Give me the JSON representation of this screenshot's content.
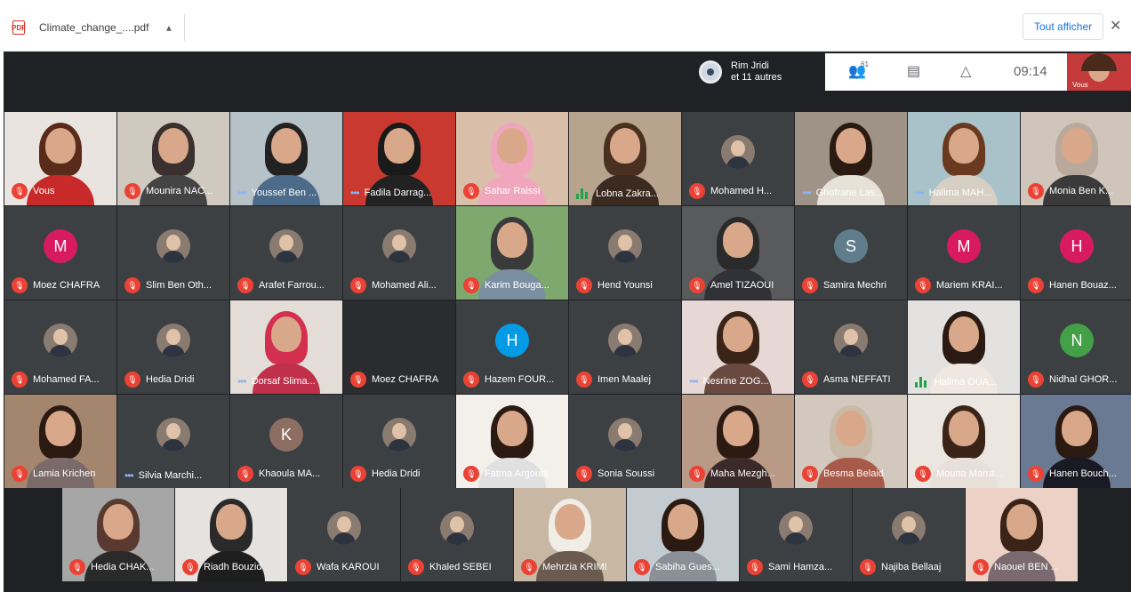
{
  "download_bar": {
    "file_name": "Climate_change_....pdf",
    "pdf_label": "PDF",
    "show_all": "Tout afficher",
    "close": "✕"
  },
  "meeting": {
    "active_speaker": {
      "line1": "Rim Jridi",
      "line2": "et 11 autres"
    },
    "participant_count": "61",
    "time": "09:14",
    "self_label": "Vous"
  },
  "colors": {
    "mic_off": "#ea4335",
    "background": "#202124",
    "tile": "#3c4043"
  },
  "participants": [
    {
      "name": "Vous",
      "mic": "off",
      "kind": "video",
      "scene": "red"
    },
    {
      "name": "Mounira NAC...",
      "mic": "off",
      "kind": "video",
      "scene": "office"
    },
    {
      "name": "Youssef Ben ...",
      "mic": "dots",
      "kind": "video",
      "scene": "office2"
    },
    {
      "name": "Fadila Darrag...",
      "mic": "dots",
      "kind": "video",
      "scene": "flag"
    },
    {
      "name": "Sahar Raissi",
      "mic": "off",
      "kind": "video",
      "scene": "hijab"
    },
    {
      "name": "Lobna Zakra...",
      "mic": "bars",
      "kind": "video",
      "scene": "curly"
    },
    {
      "name": "Mohamed H...",
      "mic": "off",
      "kind": "photo"
    },
    {
      "name": "Ghofrane Las...",
      "mic": "dots",
      "kind": "video",
      "scene": "glasses"
    },
    {
      "name": "Halima MAH...",
      "mic": "dots",
      "kind": "video",
      "scene": "kitchen"
    },
    {
      "name": "Monia Ben K...",
      "mic": "off",
      "kind": "video",
      "scene": "hijab2"
    },
    {
      "name": "Moez CHAFRA",
      "mic": "off",
      "kind": "letter",
      "letter": "M",
      "color": "#d81b60"
    },
    {
      "name": "Slim Ben Oth...",
      "mic": "off",
      "kind": "photo"
    },
    {
      "name": "Arafet Farrou...",
      "mic": "off",
      "kind": "photo"
    },
    {
      "name": "Mohamed Ali...",
      "mic": "off",
      "kind": "photo"
    },
    {
      "name": "Karim Bouga...",
      "mic": "off",
      "kind": "video",
      "scene": "green"
    },
    {
      "name": "Hend Younsi",
      "mic": "off",
      "kind": "photo"
    },
    {
      "name": "Amel TIZAOUI",
      "mic": "off",
      "kind": "video",
      "scene": "room"
    },
    {
      "name": "Samira Mechri",
      "mic": "off",
      "kind": "letter",
      "letter": "S",
      "color": "#607d8b"
    },
    {
      "name": "Mariem KRAI...",
      "mic": "off",
      "kind": "letter",
      "letter": "M",
      "color": "#d81b60"
    },
    {
      "name": "Hanen Bouaz...",
      "mic": "off",
      "kind": "letter",
      "letter": "H",
      "color": "#d81b60"
    },
    {
      "name": "Mohamed FA...",
      "mic": "off",
      "kind": "photo"
    },
    {
      "name": "Hedia Dridi",
      "mic": "off",
      "kind": "photo"
    },
    {
      "name": "Dorsaf Slima...",
      "mic": "dots",
      "kind": "video",
      "scene": "redhijab"
    },
    {
      "name": "Moez CHAFRA",
      "mic": "off",
      "kind": "blank"
    },
    {
      "name": "Hazem FOUR...",
      "mic": "off",
      "kind": "letter",
      "letter": "H",
      "color": "#039be5"
    },
    {
      "name": "Imen Maalej",
      "mic": "off",
      "kind": "photo"
    },
    {
      "name": "Nesrine ZOG...",
      "mic": "dots",
      "kind": "video",
      "scene": "pink"
    },
    {
      "name": "Asma NEFFATI",
      "mic": "off",
      "kind": "photo"
    },
    {
      "name": "Halima OUA...",
      "mic": "bars",
      "kind": "video",
      "scene": "light"
    },
    {
      "name": "Nidhal GHOR...",
      "mic": "off",
      "kind": "letter",
      "letter": "N",
      "color": "#43a047"
    },
    {
      "name": "Lamia Krichen",
      "mic": "off",
      "kind": "video",
      "scene": "books"
    },
    {
      "name": "Silvia Marchi...",
      "mic": "dots",
      "kind": "photo"
    },
    {
      "name": "Khaoula MA...",
      "mic": "off",
      "kind": "letter",
      "letter": "K",
      "color": "#8d6e63"
    },
    {
      "name": "Hedia Dridi",
      "mic": "off",
      "kind": "photo"
    },
    {
      "name": "Fatma Argoubi",
      "mic": "off",
      "kind": "video",
      "scene": "white"
    },
    {
      "name": "Sonia Soussi",
      "mic": "off",
      "kind": "photo"
    },
    {
      "name": "Maha Mezgh...",
      "mic": "off",
      "kind": "video",
      "scene": "warm"
    },
    {
      "name": "Besma Belaid",
      "mic": "off",
      "kind": "video",
      "scene": "older"
    },
    {
      "name": "Mouna Marra...",
      "mic": "off",
      "kind": "video",
      "scene": "bright"
    },
    {
      "name": "Hanen Bouch...",
      "mic": "off",
      "kind": "video",
      "scene": "desk"
    },
    {
      "name": "Hedia CHAK...",
      "mic": "off",
      "kind": "video",
      "scene": "grey"
    },
    {
      "name": "Riadh Bouzid",
      "mic": "off",
      "kind": "video",
      "scene": "man"
    },
    {
      "name": "Wafa KAROUI",
      "mic": "off",
      "kind": "photo"
    },
    {
      "name": "Khaled SEBEI",
      "mic": "off",
      "kind": "photo"
    },
    {
      "name": "Mehrzia KRIMI",
      "mic": "off",
      "kind": "video",
      "scene": "whitehijab"
    },
    {
      "name": "Sabiha Gues...",
      "mic": "off",
      "kind": "video",
      "scene": "pale"
    },
    {
      "name": "Sami Hamza...",
      "mic": "off",
      "kind": "photo"
    },
    {
      "name": "Najiba Bellaaj",
      "mic": "off",
      "kind": "photo"
    },
    {
      "name": "Naouel BEN ...",
      "mic": "off",
      "kind": "video",
      "scene": "wall"
    }
  ]
}
